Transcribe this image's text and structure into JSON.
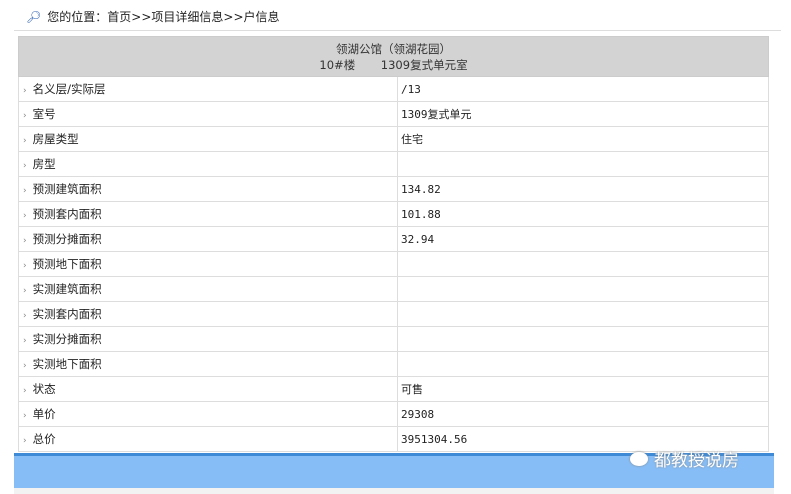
{
  "breadcrumb": {
    "label": "您的位置：",
    "items": [
      "首页",
      ">>",
      "项目详细信息",
      ">>",
      "户信息"
    ]
  },
  "header": {
    "project": "领湖公馆（领湖花园）",
    "building": "10#楼",
    "unit": "1309复式单元室"
  },
  "rows": [
    {
      "key": "名义层/实际层",
      "value": "/13"
    },
    {
      "key": "室号",
      "value": "1309复式单元"
    },
    {
      "key": "房屋类型",
      "value": "住宅"
    },
    {
      "key": "房型",
      "value": ""
    },
    {
      "key": "预测建筑面积",
      "value": "134.82"
    },
    {
      "key": "预测套内面积",
      "value": "101.88"
    },
    {
      "key": "预测分摊面积",
      "value": "32.94"
    },
    {
      "key": "预测地下面积",
      "value": ""
    },
    {
      "key": "实测建筑面积",
      "value": ""
    },
    {
      "key": "实测套内面积",
      "value": ""
    },
    {
      "key": "实测分摊面积",
      "value": ""
    },
    {
      "key": "实测地下面积",
      "value": ""
    },
    {
      "key": "状态",
      "value": "可售"
    },
    {
      "key": "单价",
      "value": "29308"
    },
    {
      "key": "总价",
      "value": "3951304.56"
    }
  ],
  "watermark": "都教授说房"
}
